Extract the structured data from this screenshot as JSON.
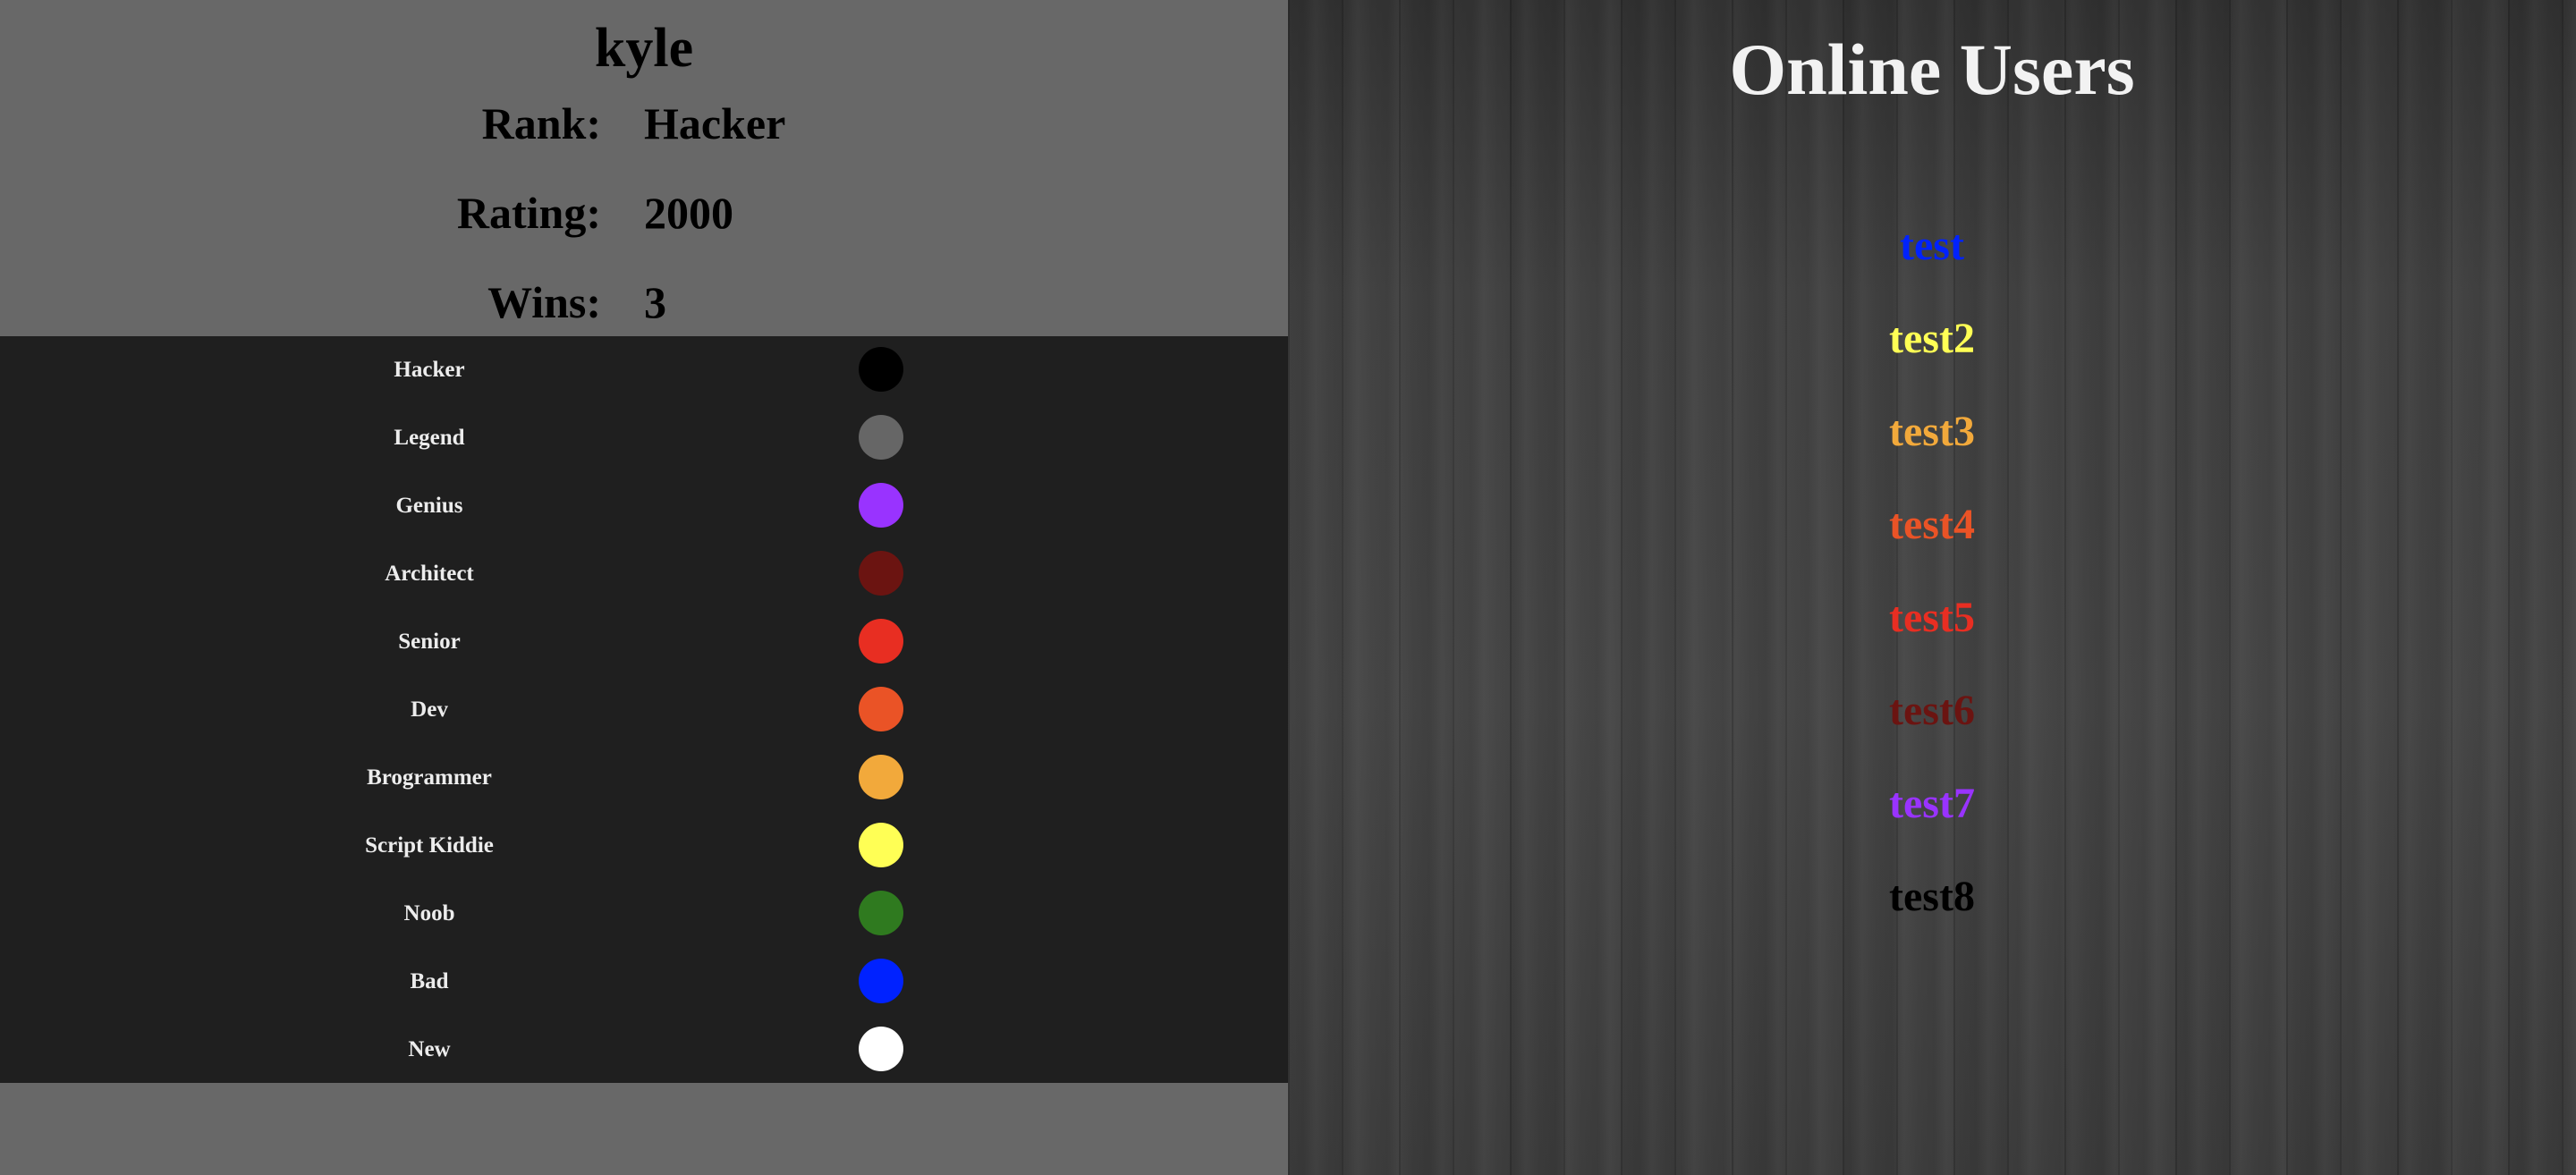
{
  "profile": {
    "username": "kyle",
    "rank_label": "Rank:",
    "rank_value": "Hacker",
    "rating_label": "Rating:",
    "rating_value": "2000",
    "wins_label": "Wins:",
    "wins_value": "3"
  },
  "legend": [
    {
      "label": "Hacker",
      "color": "#000000"
    },
    {
      "label": "Legend",
      "color": "#666666"
    },
    {
      "label": "Genius",
      "color": "#9933ff"
    },
    {
      "label": "Architect",
      "color": "#6b1411"
    },
    {
      "label": "Senior",
      "color": "#e82e22"
    },
    {
      "label": "Dev",
      "color": "#ea5326"
    },
    {
      "label": "Brogrammer",
      "color": "#f2a93b"
    },
    {
      "label": "Script Kiddie",
      "color": "#ffff55"
    },
    {
      "label": "Noob",
      "color": "#2f7a1f"
    },
    {
      "label": "Bad",
      "color": "#0022ff"
    },
    {
      "label": "New",
      "color": "#ffffff"
    }
  ],
  "online": {
    "title": "Online Users",
    "users": [
      {
        "name": "test",
        "color": "#0022ff"
      },
      {
        "name": "test2",
        "color": "#ffff55"
      },
      {
        "name": "test3",
        "color": "#f2a93b"
      },
      {
        "name": "test4",
        "color": "#ea5326"
      },
      {
        "name": "test5",
        "color": "#e82e22"
      },
      {
        "name": "test6",
        "color": "#6b1411"
      },
      {
        "name": "test7",
        "color": "#9933ff"
      },
      {
        "name": "test8",
        "color": "#000000"
      }
    ]
  }
}
